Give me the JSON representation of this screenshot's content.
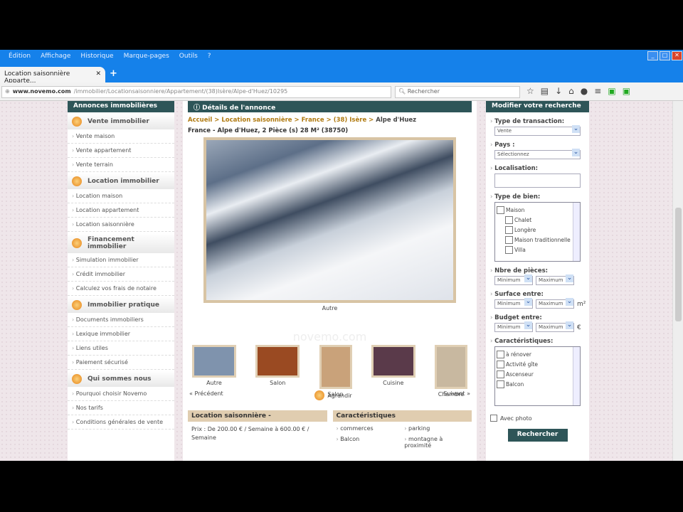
{
  "browser": {
    "menu": [
      "Édition",
      "Affichage",
      "Historique",
      "Marque-pages",
      "Outils",
      "?"
    ],
    "tab_title": "Location saisonnière Apparte...",
    "url_domain": "www.novemo.com",
    "url_path": "/immobilier/Locationsaisonniere/Appartement/(38)Isère/Alpe-d'Huez/10295",
    "search_placeholder": "Rechercher"
  },
  "left": {
    "header": "Annonces immobilières",
    "sections": [
      {
        "title": "Vente immobilier",
        "links": [
          "Vente maison",
          "Vente appartement",
          "Vente terrain"
        ]
      },
      {
        "title": "Location immobilier",
        "links": [
          "Location maison",
          "Location appartement",
          "Location saisonnière"
        ]
      },
      {
        "title": "Financement immobilier",
        "links": [
          "Simulation immobilier",
          "Crédit immobilier",
          "Calculez vos frais de notaire"
        ]
      },
      {
        "title": "Immobilier pratique",
        "links": [
          "Documents immobiliers",
          "Lexique immobilier",
          "Liens utiles",
          "Paiement sécurisé"
        ]
      },
      {
        "title": "Qui sommes nous",
        "links": [
          "Pourquoi choisir Novemo",
          "Nos tarifs",
          "Conditions générales de vente"
        ]
      }
    ]
  },
  "center": {
    "header": "Détails de l'annonce",
    "breadcrumb": [
      "Accueil",
      "Location saisonnière",
      "France",
      "(38) Isère",
      "Alpe d'Huez"
    ],
    "title": "France - Alpe d'Huez, 2 Pièce (s) 28 M² (38750)",
    "photo_caption": "Autre",
    "watermark": "novemo.com",
    "thumbs": [
      {
        "label": "Autre",
        "color": "#7f93ad"
      },
      {
        "label": "Salon",
        "color": "#9a4a22"
      },
      {
        "label": "Salon",
        "color": "#c9a27a"
      },
      {
        "label": "Cuisine",
        "color": "#5a3a4a"
      },
      {
        "label": "Chambre",
        "color": "#c8b8a0"
      }
    ],
    "prev": "« Précédent",
    "next": "Suivant »",
    "enlarge": "Agrandir",
    "rental_header": "Location saisonnière -",
    "price": "Prix : De 200.00 € / Semaine à 600.00 € / Semaine",
    "features_header": "Caractéristiques",
    "features": [
      "commerces",
      "parking",
      "Balcon",
      "montagne à proximité"
    ]
  },
  "right": {
    "header": "Modifier votre recherche",
    "transaction_label": "Type de transaction:",
    "transaction_value": "Vente",
    "country_label": "Pays :",
    "country_value": "Sélectionnez",
    "location_label": "Localisation:",
    "type_label": "Type de bien:",
    "types": [
      "Maison",
      "Chalet",
      "Longère",
      "Maison traditionnelle",
      "Villa"
    ],
    "rooms_label": "Nbre de pièces:",
    "surface_label": "Surface entre:",
    "budget_label": "Budget entre:",
    "min": "Minimum",
    "max": "Maximum",
    "m2": "m²",
    "euro": "€",
    "char_label": "Caractéristiques:",
    "chars": [
      "à rénover",
      "Activité gîte",
      "Ascenseur",
      "Balcon"
    ],
    "photo_label": "Avec photo",
    "search_btn": "Rechercher"
  }
}
